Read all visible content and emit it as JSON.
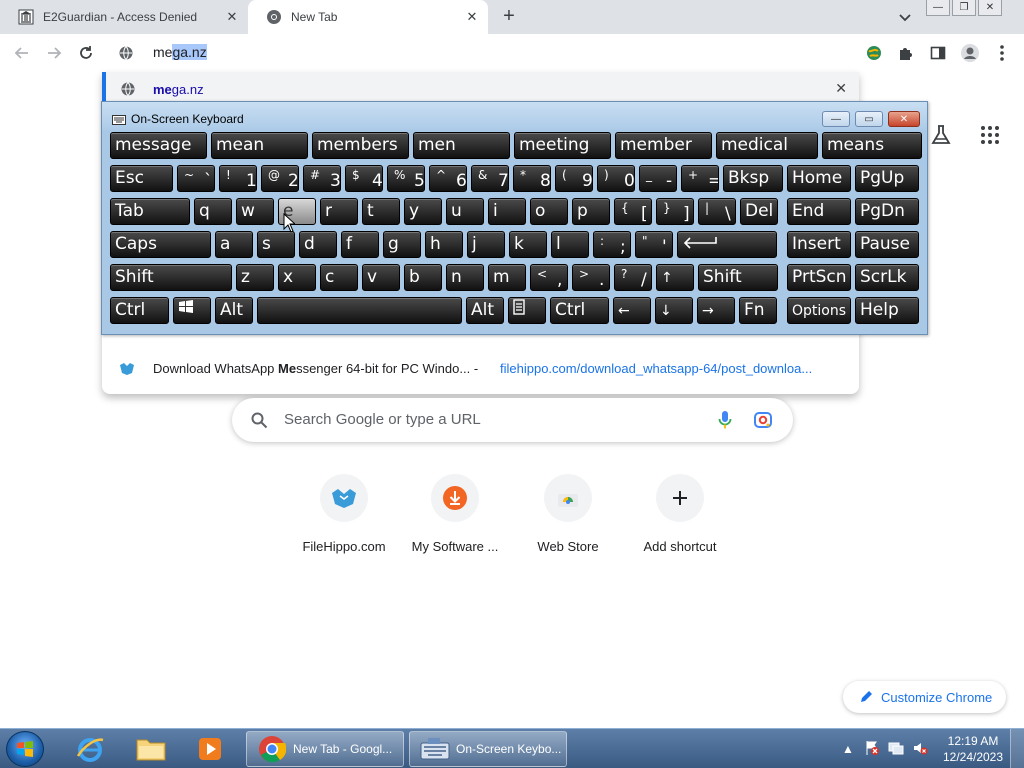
{
  "browser": {
    "tabs": [
      {
        "title": "E2Guardian - Access Denied",
        "active": false
      },
      {
        "title": "New Tab",
        "active": true
      }
    ],
    "omnibox": {
      "typed": "me",
      "autocomplete": "ga.nz"
    },
    "suggestions": [
      {
        "bold": "me",
        "rest": "ga.nz",
        "type": "url"
      },
      {
        "title_pre": "Download WhatsApp ",
        "title_bold": "Me",
        "title_post": "ssenger 64-bit for PC Windo...",
        "separator": " - ",
        "url": "filehippo.com/download_whatsapp-64/post_downloa..."
      }
    ]
  },
  "page": {
    "search_placeholder": "Search Google or type a URL",
    "shortcuts": [
      {
        "label": "FileHippo.com",
        "icon": "filehippo-icon"
      },
      {
        "label": "My Software ...",
        "icon": "download-icon"
      },
      {
        "label": "Web Store",
        "icon": "web-store-icon"
      },
      {
        "label": "Add shortcut",
        "icon": "plus-icon"
      }
    ],
    "customize_label": "Customize Chrome"
  },
  "osk": {
    "title": "On-Screen Keyboard",
    "predictions": [
      "message",
      "mean",
      "members",
      "men",
      "meeting",
      "member",
      "medical",
      "means"
    ],
    "row1": [
      {
        "label": "Esc"
      },
      {
        "top": "~",
        "bottom": "`"
      },
      {
        "top": "!",
        "bottom": "1"
      },
      {
        "top": "@",
        "bottom": "2"
      },
      {
        "top": "#",
        "bottom": "3"
      },
      {
        "top": "$",
        "bottom": "4"
      },
      {
        "top": "%",
        "bottom": "5"
      },
      {
        "top": "^",
        "bottom": "6"
      },
      {
        "top": "&",
        "bottom": "7"
      },
      {
        "top": "*",
        "bottom": "8"
      },
      {
        "top": "(",
        "bottom": "9"
      },
      {
        "top": ")",
        "bottom": "0"
      },
      {
        "top": "_",
        "bottom": "-"
      },
      {
        "top": "+",
        "bottom": "="
      },
      {
        "label": "Bksp"
      },
      {
        "label": "Home"
      },
      {
        "label": "PgUp"
      }
    ],
    "row2": [
      "Tab",
      "q",
      "w",
      "e",
      "r",
      "t",
      "y",
      "u",
      "i",
      "o",
      "p",
      "[",
      "]",
      "\\",
      "Del",
      "End",
      "PgDn"
    ],
    "row2_tops": {
      "[": "{",
      "]": "}",
      "\\": "|"
    },
    "row3": [
      "Caps",
      "a",
      "s",
      "d",
      "f",
      "g",
      "h",
      "j",
      "k",
      "l",
      ";",
      "'",
      "Enter",
      "Insert",
      "Pause"
    ],
    "row3_tops": {
      ";": ":",
      "'": "\""
    },
    "row4": [
      "Shift",
      "z",
      "x",
      "c",
      "v",
      "b",
      "n",
      "m",
      ",",
      ".",
      "/",
      "↑",
      "Shift",
      "PrtScn",
      "ScrLk"
    ],
    "row4_tops": {
      ",": "<",
      ".": ">",
      "/": "?"
    },
    "row5": [
      "Ctrl",
      "win",
      "Alt",
      "",
      "Alt",
      "menu",
      "Ctrl",
      "←",
      "↓",
      "→",
      "Fn",
      "Options",
      "Help"
    ],
    "pressed_key": "e"
  },
  "taskbar": {
    "tasks": [
      {
        "label": "New Tab - Googl...",
        "icon": "chrome-icon"
      },
      {
        "label": "On-Screen Keybo...",
        "icon": "keyboard-icon"
      }
    ],
    "time": "12:19 AM",
    "date": "12/24/2023"
  },
  "colors": {
    "accent": "#1a73e8",
    "tabstrip": "#dee1e6",
    "osk_frame": "#a8c8e6",
    "key_face": "#111111",
    "taskbar": "#3a5a82"
  }
}
